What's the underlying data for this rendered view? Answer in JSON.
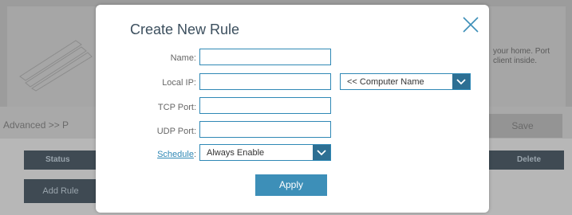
{
  "background": {
    "hint_line1": "your home. Port",
    "hint_line2": "client inside.",
    "breadcrumb": "Advanced >> P",
    "save_label": "Save",
    "table_header": {
      "status": "Status",
      "delete": "Delete"
    },
    "add_rule_label": "Add Rule"
  },
  "modal": {
    "title": "Create New Rule",
    "fields": {
      "name_label": "Name:",
      "name_value": "",
      "local_ip_label": "Local IP:",
      "local_ip_value": "",
      "computer_name_select": "<< Computer Name",
      "tcp_port_label": "TCP Port:",
      "tcp_port_value": "",
      "udp_port_label": "UDP Port:",
      "udp_port_value": "",
      "schedule_label": "Schedule",
      "schedule_colon": ":",
      "schedule_value": "Always Enable"
    },
    "apply_label": "Apply"
  },
  "icons": [
    "close-icon",
    "chevron-down-icon"
  ],
  "colors": {
    "accent": "#2f88b5",
    "select_button": "#2d6f93",
    "apply": "#3d8fb8",
    "title": "#3c4f5e"
  }
}
